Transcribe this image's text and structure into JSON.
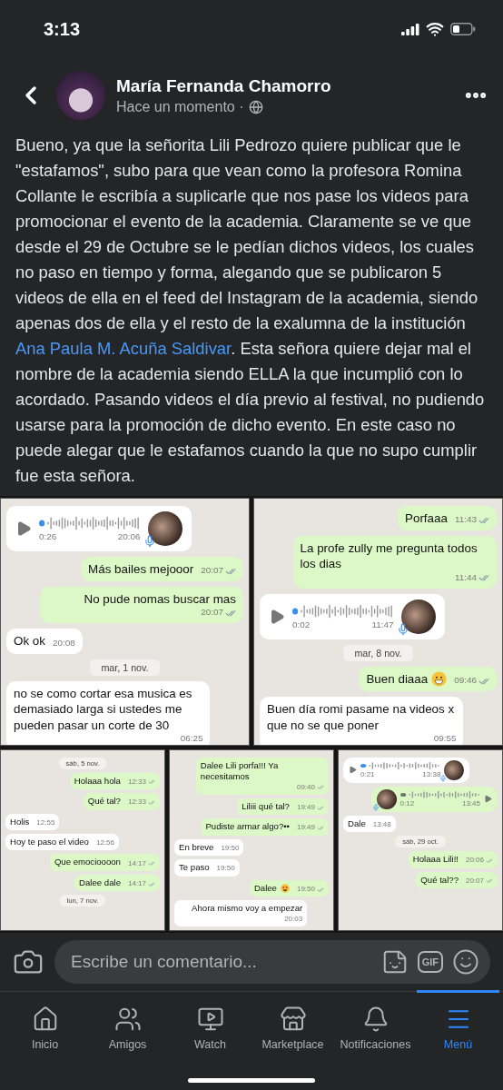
{
  "status_bar": {
    "time": "3:13"
  },
  "post": {
    "author": "María Fernanda Chamorro",
    "timestamp": "Hace un momento ·",
    "body": [
      {
        "kind": "text",
        "text": "Bueno, ya que la señorita Lili Pedrozo quiere publicar que le \"estafamos\", subo para que vean como la profesora Romina Collante le escribía a suplicarle que nos pase los videos para promocionar el evento de la academia. Claramente se ve que desde el 29 de Octubre se le pedían dichos videos, los cuales no paso en tiempo y forma, alegando que se publicaron 5 videos de ella en el feed del Instagram de la academia, siendo apenas dos de ella y el resto de la exalumna de la institución "
      },
      {
        "kind": "link",
        "text": "Ana Paula M. Acuña Saldivar"
      },
      {
        "kind": "text",
        "text": ". Esta señora quiere dejar mal el nombre de la academia siendo ELLA la que incumplió con lo acordado. Pasando videos el día previo al festival, no pudiendo usarse para la promoción de dicho evento. En este caso no puede alegar que le estafamos cuando la que no supo cumplir fue esta señora."
      }
    ],
    "chat_screenshots": {
      "rows": [
        [
          {
            "messages": [
              {
                "kind": "voice",
                "outgoing": false,
                "duration": "0:26",
                "time": "20:06"
              },
              {
                "kind": "text",
                "outgoing": true,
                "text": "Más bailes mejooor",
                "time": "20:07"
              },
              {
                "kind": "text",
                "outgoing": true,
                "text": "No pude nomas buscar mas",
                "time": "20:07"
              },
              {
                "kind": "text",
                "outgoing": false,
                "text": "Ok ok",
                "time": "20:08"
              },
              {
                "kind": "date",
                "text": "mar, 1 nov."
              },
              {
                "kind": "text",
                "outgoing": false,
                "text": "no se como cortar esa musica es demasiado larga si ustedes me pueden pasar un corte de 30",
                "time": "06:25"
              }
            ]
          },
          {
            "messages": [
              {
                "kind": "text",
                "outgoing": true,
                "text": "Porfaaa",
                "time": "11:43"
              },
              {
                "kind": "text",
                "outgoing": true,
                "text": "La profe zully me pregunta todos los dias",
                "time": "11:44"
              },
              {
                "kind": "voice",
                "outgoing": false,
                "duration": "0:02",
                "time": "11:47"
              },
              {
                "kind": "date",
                "text": "mar, 8 nov."
              },
              {
                "kind": "text",
                "outgoing": true,
                "text": "Buen diaaa",
                "emoji": {
                  "kind": "grin"
                },
                "time": "09:46"
              },
              {
                "kind": "text",
                "outgoing": false,
                "text": "Buen día romi pasame na videos x que no se que poner",
                "time": "09:55"
              }
            ]
          }
        ],
        [
          {
            "messages": [
              {
                "kind": "date",
                "text": "sáb, 5 nov."
              },
              {
                "kind": "text",
                "outgoing": true,
                "text": "Holaaa hola",
                "time": "12:33"
              },
              {
                "kind": "text",
                "outgoing": true,
                "text": "Qué tal?",
                "time": "12:33"
              },
              {
                "kind": "text",
                "outgoing": false,
                "text": "Holis",
                "time": "12:55"
              },
              {
                "kind": "text",
                "outgoing": false,
                "text": "Hoy te paso el video",
                "time": "12:56"
              },
              {
                "kind": "text",
                "outgoing": true,
                "text": "Que emocioooon",
                "time": "14:17"
              },
              {
                "kind": "text",
                "outgoing": true,
                "text": "Dalee dale",
                "time": "14:17"
              },
              {
                "kind": "date",
                "text": "lun, 7 nov."
              }
            ]
          },
          {
            "messages": [
              {
                "kind": "text",
                "outgoing": true,
                "text": "Dalee Lili porfa!!! Ya necesitamos",
                "time": "09:40"
              },
              {
                "kind": "text",
                "outgoing": true,
                "text": "Liliii qué tal?",
                "time": "19:49"
              },
              {
                "kind": "text",
                "outgoing": true,
                "text": "Pudiste armar algo?••",
                "time": "19:49"
              },
              {
                "kind": "text",
                "outgoing": false,
                "text": "En breve",
                "time": "19:50"
              },
              {
                "kind": "text",
                "outgoing": false,
                "text": "Te paso",
                "time": "19:50"
              },
              {
                "kind": "text",
                "outgoing": true,
                "text": "Dalee",
                "emoji": {
                  "kind": "star-eyes"
                },
                "time": "19:50"
              },
              {
                "kind": "text",
                "outgoing": false,
                "text": "Ahora mismo voy a empezar",
                "time": "20:03"
              }
            ]
          },
          {
            "messages": [
              {
                "kind": "voice",
                "outgoing": false,
                "duration": "0:21",
                "time": "13:38"
              },
              {
                "kind": "voice",
                "outgoing": true,
                "duration": "0:12",
                "time": "13:45"
              },
              {
                "kind": "text",
                "outgoing": false,
                "text": "Dale",
                "time": "13:48"
              },
              {
                "kind": "date",
                "text": "sáb, 29 oct."
              },
              {
                "kind": "text",
                "outgoing": true,
                "text": "Holaaa Lili!!",
                "time": "20:06"
              },
              {
                "kind": "text",
                "outgoing": true,
                "text": "Qué tal??",
                "time": "20:07"
              }
            ]
          }
        ]
      ]
    }
  },
  "comment_bar": {
    "placeholder": "Escribe un comentario...",
    "gif_label": "GIF"
  },
  "tab_bar": [
    {
      "kind": "home",
      "label": "Inicio",
      "selected": false
    },
    {
      "kind": "friends",
      "label": "Amigos",
      "selected": false
    },
    {
      "kind": "watch",
      "label": "Watch",
      "selected": false
    },
    {
      "kind": "marketplace",
      "label": "Marketplace",
      "selected": false
    },
    {
      "kind": "notifications",
      "label": "Notificaciones",
      "selected": false
    },
    {
      "kind": "menu",
      "label": "Menú",
      "selected": true
    }
  ]
}
